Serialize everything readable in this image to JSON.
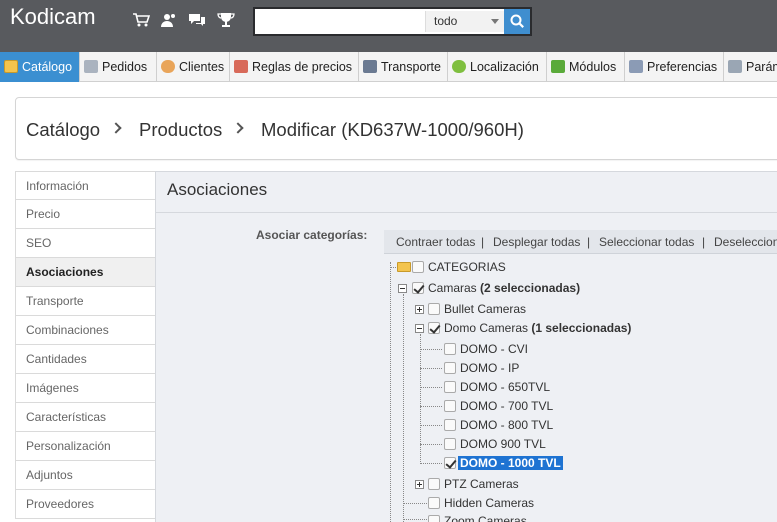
{
  "header": {
    "logo": "Kodicam",
    "icons": [
      "cart-icon",
      "customers-icon",
      "messages-icon",
      "trophy-icon"
    ],
    "search": {
      "value": "",
      "placeholder": "",
      "scope": "todo"
    }
  },
  "nav": {
    "tabs": [
      {
        "label": "Catálogo",
        "icon": "folder-icon",
        "active": true
      },
      {
        "label": "Pedidos",
        "icon": "cart-icon"
      },
      {
        "label": "Clientes",
        "icon": "user-icon"
      },
      {
        "label": "Reglas de precios",
        "icon": "price-rules-icon"
      },
      {
        "label": "Transporte",
        "icon": "truck-icon"
      },
      {
        "label": "Localización",
        "icon": "globe-icon"
      },
      {
        "label": "Módulos",
        "icon": "puzzle-icon"
      },
      {
        "label": "Preferencias",
        "icon": "preferences-icon"
      },
      {
        "label": "Parám",
        "icon": "wrench-icon"
      }
    ]
  },
  "breadcrumb": {
    "items": [
      "Catálogo",
      "Productos",
      "Modificar (KD637W-1000/960H)"
    ]
  },
  "sidemenu": {
    "items": [
      {
        "label": "Información"
      },
      {
        "label": "Precio"
      },
      {
        "label": "SEO"
      },
      {
        "label": "Asociaciones",
        "active": true
      },
      {
        "label": "Transporte"
      },
      {
        "label": "Combinaciones"
      },
      {
        "label": "Cantidades"
      },
      {
        "label": "Imágenes"
      },
      {
        "label": "Características"
      },
      {
        "label": "Personalización"
      },
      {
        "label": "Adjuntos"
      },
      {
        "label": "Proveedores"
      }
    ]
  },
  "main": {
    "title": "Asociaciones",
    "assoc_label": "Asociar categorías:",
    "toolbar": [
      "Contraer todas",
      "Desplegar todas",
      "Seleccionar todas",
      "Deseleccionar"
    ],
    "toolbar_sep": "|",
    "tree": {
      "root": "CATEGORIAS",
      "camaras": {
        "label": "Camaras",
        "count": "(2 seleccionadas)"
      },
      "bullet": "Bullet Cameras",
      "domo": {
        "label": "Domo Cameras",
        "count": "(1 seleccionadas)"
      },
      "domo_children": [
        "DOMO - CVI",
        "DOMO - IP",
        "DOMO - 650TVL",
        "DOMO - 700 TVL",
        "DOMO - 800 TVL",
        "DOMO 900 TVL",
        "DOMO - 1000 TVL"
      ],
      "ptz": "PTZ Cameras",
      "hidden": "Hidden Cameras",
      "zoom": "Zoom Cameras"
    }
  },
  "colors": {
    "accent": "#3b8fd1",
    "header_bg": "#585a5e",
    "selected": "#1e73d2"
  }
}
